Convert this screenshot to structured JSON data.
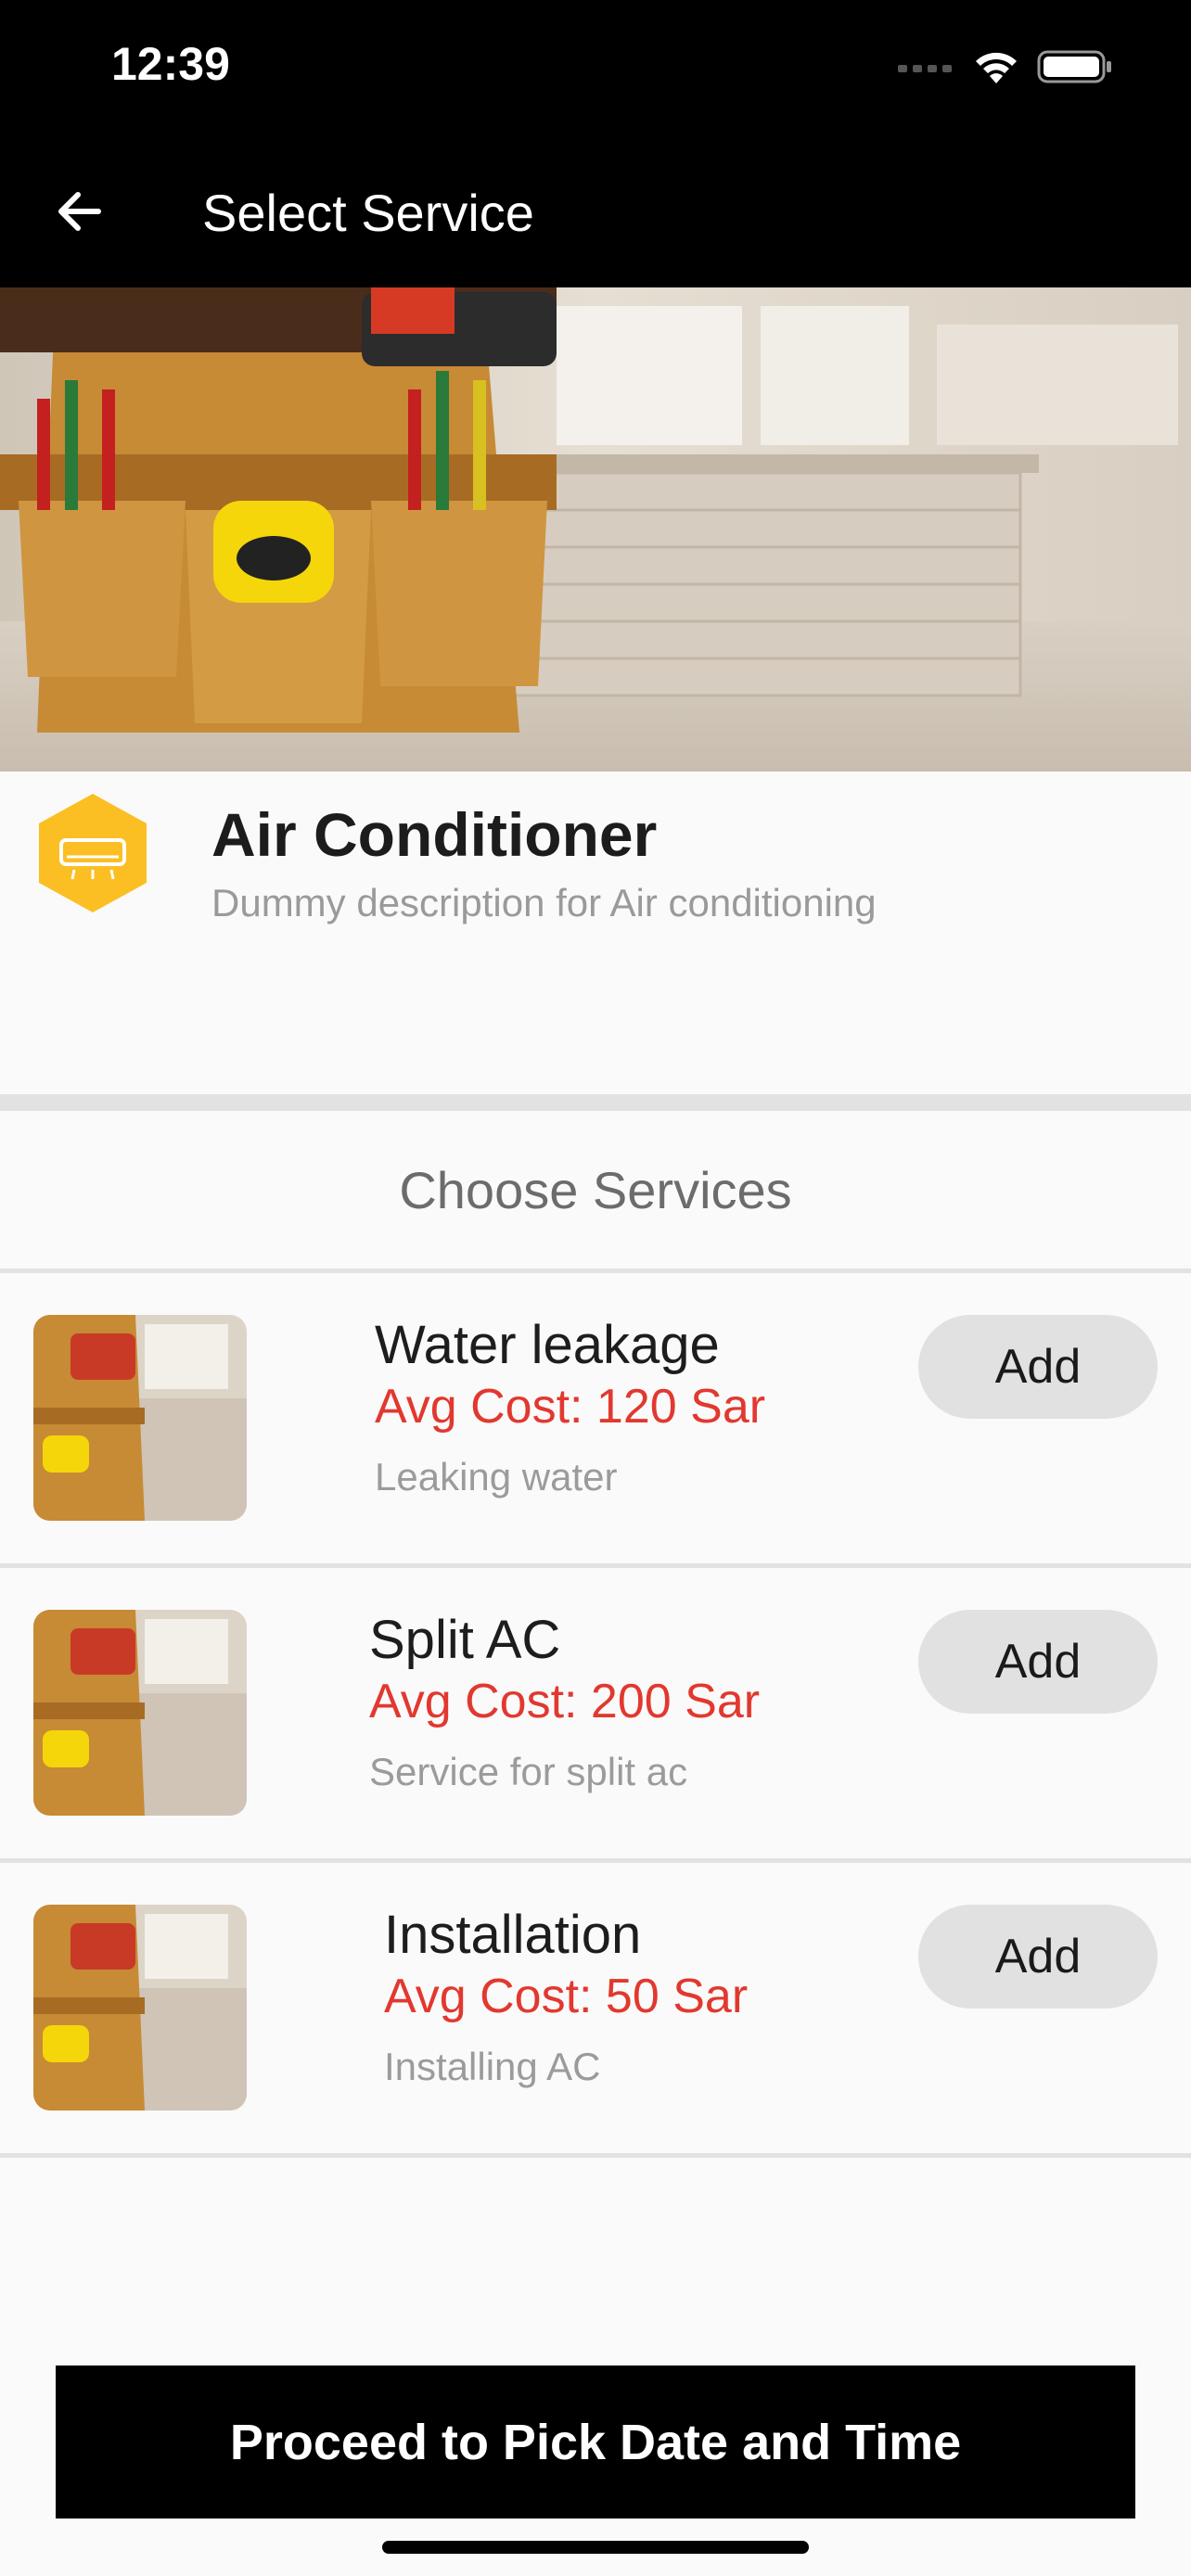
{
  "status_bar": {
    "time": "12:39"
  },
  "app_bar": {
    "title": "Select Service"
  },
  "category": {
    "title": "Air Conditioner",
    "description": "Dummy description for Air conditioning",
    "icon": "air-conditioner-icon",
    "icon_color": "#fbbf24"
  },
  "section_title": "Choose Services",
  "services": [
    {
      "name": "Water leakage",
      "cost": "Avg Cost: 120 Sar",
      "description": "Leaking water",
      "add_label": "Add"
    },
    {
      "name": "Split AC",
      "cost": "Avg Cost: 200 Sar",
      "description": "Service for split ac",
      "add_label": "Add"
    },
    {
      "name": "Installation",
      "cost": "Avg Cost: 50 Sar",
      "description": "Installing AC",
      "add_label": "Add"
    }
  ],
  "proceed_label": "Proceed to Pick Date and Time",
  "colors": {
    "accent_red": "#e2382f",
    "bar_black": "#000000"
  }
}
